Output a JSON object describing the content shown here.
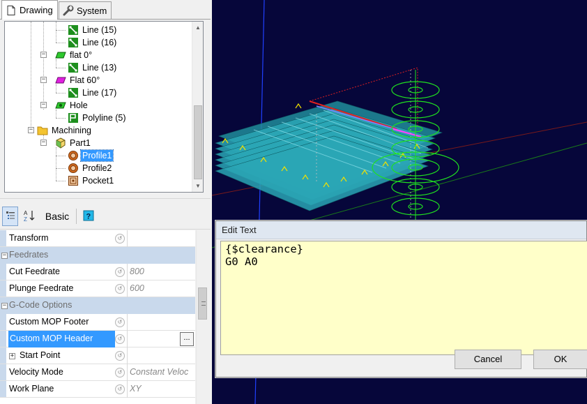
{
  "tabs": [
    {
      "label": "Drawing",
      "icon": "document-icon"
    },
    {
      "label": "System",
      "icon": "wrench-icon"
    }
  ],
  "tree": [
    {
      "label": "Line (15)",
      "icon": "line-icon"
    },
    {
      "label": "Line (16)",
      "icon": "line-icon"
    },
    {
      "label": "flat 0°",
      "icon": "layer-green-icon"
    },
    {
      "label": "Line (13)",
      "icon": "line-icon"
    },
    {
      "label": "Flat 60°",
      "icon": "layer-magenta-icon"
    },
    {
      "label": "Line (17)",
      "icon": "line-icon"
    },
    {
      "label": "Hole",
      "icon": "layer-green-icon"
    },
    {
      "label": "Polyline (5)",
      "icon": "polyline-icon"
    },
    {
      "label": "Machining",
      "icon": "folder-icon"
    },
    {
      "label": "Part1",
      "icon": "part-icon"
    },
    {
      "label": "Profile1",
      "icon": "profile-icon",
      "selected": true
    },
    {
      "label": "Profile2",
      "icon": "profile-icon"
    },
    {
      "label": "Pocket1",
      "icon": "pocket-icon"
    }
  ],
  "toolbar": {
    "categorized_icon": "categorized-view-icon",
    "alphabetical_icon": "sort-az-icon",
    "basic_label": "Basic",
    "help_icon": "help-icon"
  },
  "properties": [
    {
      "kind": "prop",
      "name": "Transform",
      "value": ""
    },
    {
      "kind": "cat",
      "name": "Feedrates"
    },
    {
      "kind": "prop",
      "name": "Cut Feedrate",
      "value": "800"
    },
    {
      "kind": "prop",
      "name": "Plunge Feedrate",
      "value": "600"
    },
    {
      "kind": "cat",
      "name": "G-Code Options"
    },
    {
      "kind": "prop",
      "name": "Custom MOP Footer",
      "value": ""
    },
    {
      "kind": "prop",
      "name": "Custom MOP Header",
      "value": "",
      "selected": true,
      "button": "..."
    },
    {
      "kind": "prop",
      "name": "Start Point",
      "value": "",
      "expander": "+"
    },
    {
      "kind": "prop",
      "name": "Velocity Mode",
      "value": "Constant Veloc"
    },
    {
      "kind": "prop",
      "name": "Work Plane",
      "value": "XY"
    }
  ],
  "dialog": {
    "title": "Edit Text",
    "text": "{$clearance}\nG0 A0",
    "cancel_label": "Cancel",
    "ok_label": "OK"
  },
  "colors": {
    "viewport_bg": "#06063a",
    "toolpath_cyan": "#2aa6b5",
    "selection_blue": "#3399ff",
    "dialog_text_bg": "#ffffc9",
    "category_bg": "#c9d9ec",
    "circle_green": "#20e020"
  }
}
